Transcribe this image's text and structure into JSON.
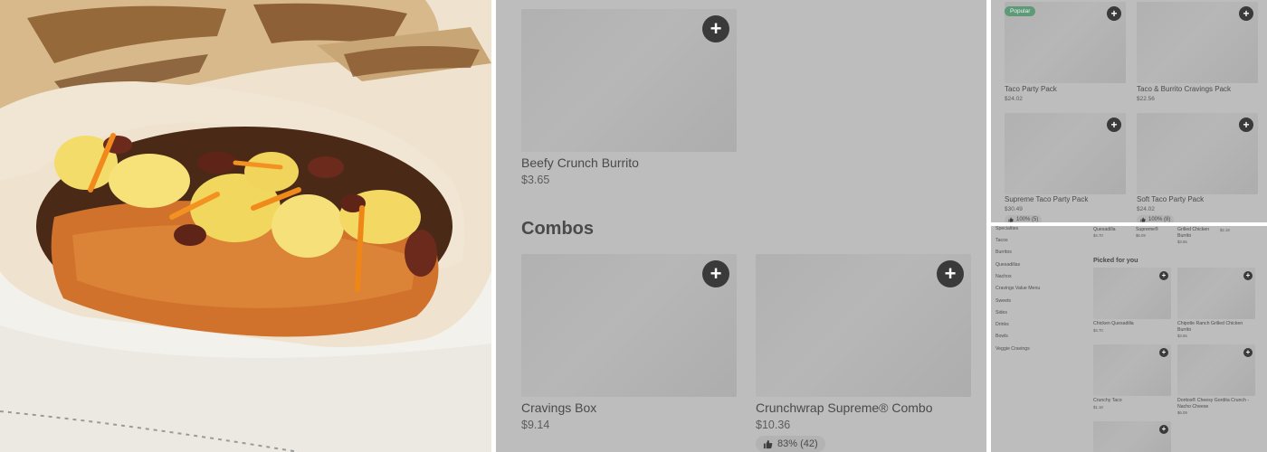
{
  "middle": {
    "top_item": {
      "name": "Beefy Crunch Burrito",
      "price": "$3.65"
    },
    "section_title": "Combos",
    "items": [
      {
        "name": "Cravings Box",
        "price": "$9.14"
      },
      {
        "name": "Crunchwrap Supreme® Combo",
        "price": "$10.36",
        "rating": "83% (42)"
      }
    ]
  },
  "top_right": {
    "badge": "Popular",
    "items": [
      {
        "name": "Taco Party Pack",
        "price": "$24.02"
      },
      {
        "name": "Taco & Burrito Cravings Pack",
        "price": "$22.56"
      },
      {
        "name": "Supreme Taco Party Pack",
        "price": "$30.49",
        "rating": "100% (5)"
      },
      {
        "name": "Soft Taco Party Pack",
        "price": "$24.02",
        "rating": "100% (8)"
      }
    ]
  },
  "bottom_right": {
    "categories": [
      "Specialties",
      "Tacos",
      "Burritos",
      "Quesadillas",
      "Nachos",
      "Cravings Value Menu",
      "Sweets",
      "Sides",
      "Drinks",
      "Bowls",
      "Veggie Cravings"
    ],
    "top_row": [
      {
        "name": "Quesadilla",
        "price": "$4.70"
      },
      {
        "name": "Supreme®",
        "price": "$6.09"
      },
      {
        "name": "Grilled Chicken Burrito",
        "price": "$3.65"
      },
      {
        "name": "",
        "price": "$2.18"
      }
    ],
    "picked_title": "Picked for you",
    "items": [
      {
        "name": "Chicken Quesadilla",
        "price": "$4.70"
      },
      {
        "name": "Chipotle Ranch Grilled Chicken Burrito",
        "price": "$3.65"
      },
      {
        "name": "Crunchy Taco",
        "price": "$1.18"
      },
      {
        "name": "Doritos® Cheesy Gordita Crunch - Nacho Cheese",
        "price": "$6.09"
      }
    ]
  },
  "icons": {
    "add": "plus-icon",
    "rating": "thumbs-up-icon"
  },
  "colors": {
    "panel_bg": "#bdbdbd",
    "add_button": "#3a3a3a",
    "badge_bg": "#5f9a78"
  },
  "glyphs": {
    "plus": "+"
  }
}
